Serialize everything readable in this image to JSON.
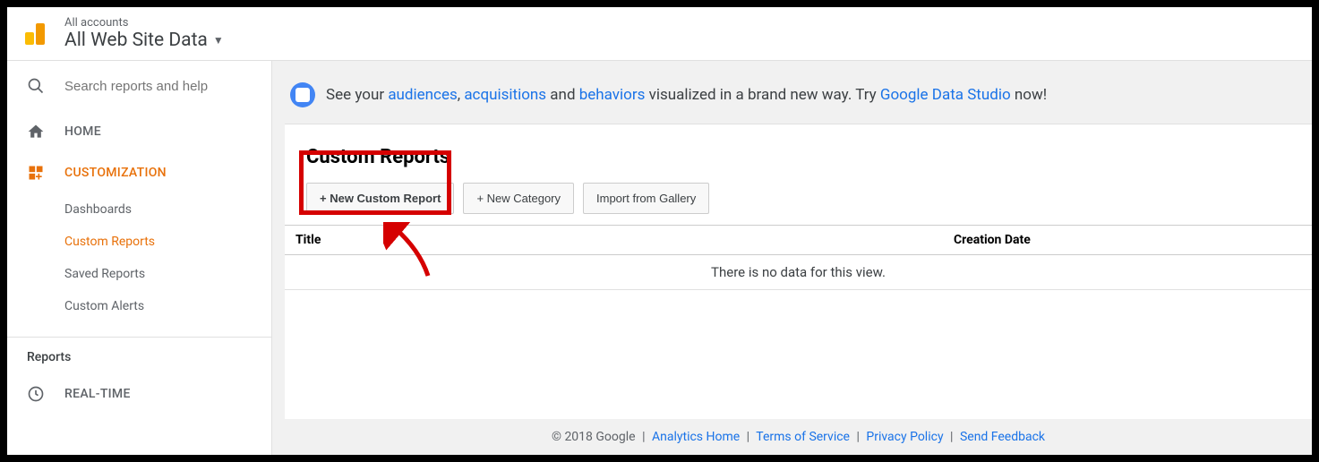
{
  "header": {
    "accounts": "All accounts",
    "title": "All Web Site Data"
  },
  "search": {
    "placeholder": "Search reports and help"
  },
  "nav": {
    "home": "HOME",
    "customization": "CUSTOMIZATION",
    "sub": {
      "dashboards": "Dashboards",
      "custom_reports": "Custom Reports",
      "saved_reports": "Saved Reports",
      "custom_alerts": "Custom Alerts"
    },
    "reports_header": "Reports",
    "realtime": "REAL-TIME"
  },
  "banner": {
    "pre": "See your ",
    "audiences": "audiences",
    "sep1": ", ",
    "acquisitions": "acquisitions",
    "sep2": " and ",
    "behaviors": "behaviors",
    "mid": " visualized in a brand new way. Try ",
    "gds": "Google Data Studio",
    "post": " now!"
  },
  "content": {
    "title": "Custom Reports",
    "btn_new_report": "+ New Custom Report",
    "btn_new_category": "+ New Category",
    "btn_import": "Import from Gallery",
    "col_title": "Title",
    "col_date": "Creation Date",
    "empty": "There is no data for this view."
  },
  "footer": {
    "copyright": "© 2018 Google",
    "analytics_home": "Analytics Home",
    "terms": "Terms of Service",
    "privacy": "Privacy Policy",
    "feedback": "Send Feedback"
  }
}
